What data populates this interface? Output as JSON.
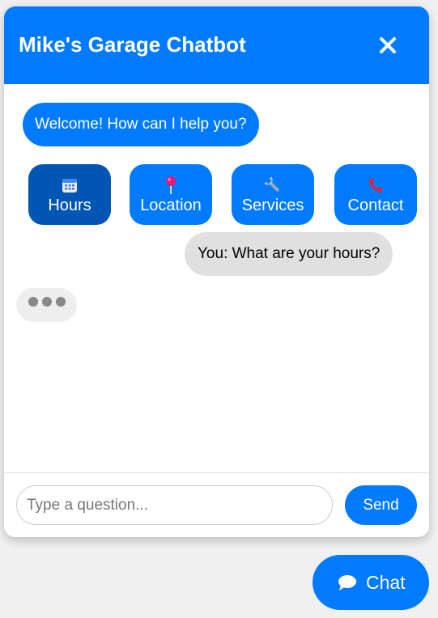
{
  "header": {
    "title": "Mike's Garage Chatbot",
    "close_icon": "close-icon"
  },
  "messages": {
    "bot_welcome": "Welcome! How can I help you?",
    "user_question": "You: What are your hours?",
    "typing": true
  },
  "quick_replies": [
    {
      "label": "Hours",
      "icon": "calendar-icon",
      "active": true
    },
    {
      "label": "Location",
      "icon": "pin-icon",
      "active": false
    },
    {
      "label": "Services",
      "icon": "wrench-icon",
      "active": false
    },
    {
      "label": "Contact",
      "icon": "phone-icon",
      "active": false
    }
  ],
  "input": {
    "placeholder": "Type a question...",
    "value": ""
  },
  "send_label": "Send",
  "launcher": {
    "label": "Chat",
    "icon": "speech-bubble-icon"
  },
  "colors": {
    "primary": "#007bff",
    "active": "#0056b3",
    "user_bubble": "#e0e0e0",
    "page_background": "#f0f0f0"
  }
}
